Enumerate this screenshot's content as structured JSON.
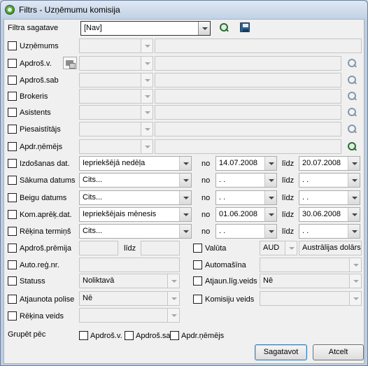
{
  "window": {
    "title": "Filtrs - Uzņēmumu komisija"
  },
  "template": {
    "label": "Filtra sagatave",
    "value": "[Nav]"
  },
  "rows": [
    {
      "label": "Uzņēmums",
      "value": ""
    },
    {
      "label": "Apdroš.v.",
      "value": ""
    },
    {
      "label": "Apdroš.sab",
      "value": ""
    },
    {
      "label": "Brokeris",
      "value": ""
    },
    {
      "label": "Asistents",
      "value": ""
    },
    {
      "label": "Piesaistītājs",
      "value": ""
    },
    {
      "label": "Apdr.ņēmējs",
      "value": ""
    }
  ],
  "date_rows": [
    {
      "label": "Izdošanas dat.",
      "period": "Iepriekšējā nedēļa",
      "no_label": "no",
      "from": "14.07.2008",
      "lidz_label": "līdz",
      "to": "20.07.2008"
    },
    {
      "label": "Sākuma datums",
      "period": "Cits...",
      "no_label": "no",
      "from": "  .  .",
      "lidz_label": "līdz",
      "to": "  .  ."
    },
    {
      "label": "Beigu datums",
      "period": "Cits...",
      "no_label": "no",
      "from": "  .  .",
      "lidz_label": "līdz",
      "to": "  .  ."
    },
    {
      "label": "Kom.aprēķ.dat.",
      "period": "Iepriekšējais mēnesis",
      "no_label": "no",
      "from": "01.06.2008",
      "lidz_label": "līdz",
      "to": "30.06.2008"
    },
    {
      "label": "Rēķina termiņš",
      "period": "Cits...",
      "no_label": "no",
      "from": "  .  .",
      "lidz_label": "līdz",
      "to": "  .  ."
    }
  ],
  "premium": {
    "label": "Apdroš.prēmija",
    "from": "",
    "lidz_label": "līdz",
    "to": ""
  },
  "currency": {
    "label": "Valūta",
    "code": "AUD",
    "name": "Austrālijas dolārs"
  },
  "car_reg": {
    "label": "Auto.reģ.nr.",
    "value": ""
  },
  "car": {
    "label": "Automašīna",
    "value": ""
  },
  "status": {
    "label": "Statuss",
    "value": "Noliktavā"
  },
  "renewal_type": {
    "label": "Atjaun.līg.veids",
    "value": "Nē"
  },
  "renewed_policy": {
    "label": "Atjaunota polise",
    "value": "Nē"
  },
  "commission_type": {
    "label": "Komisiju veids",
    "value": ""
  },
  "invoice_type": {
    "label": "Rēķina veids",
    "value": ""
  },
  "group_by": {
    "label": "Grupēt pēc",
    "options": [
      "Apdroš.v.",
      "Apdroš.sab",
      "Apdr.ņēmējs"
    ]
  },
  "buttons": {
    "prepare": "Sagatavot",
    "cancel": "Atcelt"
  }
}
